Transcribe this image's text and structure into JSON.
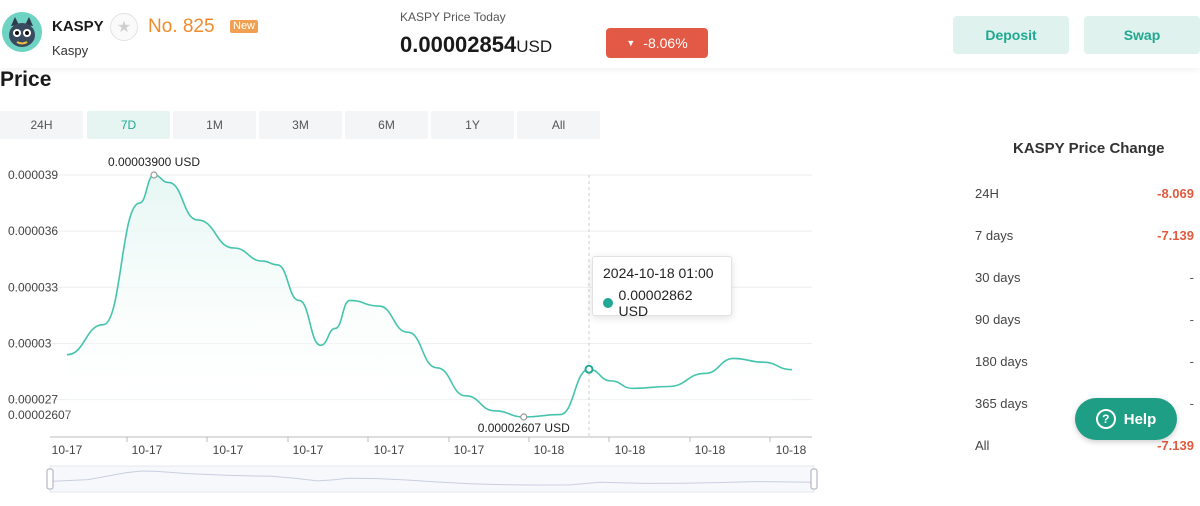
{
  "header": {
    "symbol": "KASPY",
    "name": "Kaspy",
    "rank": "No. 825",
    "new_badge": "New",
    "price_label": "KASPY Price Today",
    "price": "0.00002854",
    "price_unit": "USD",
    "change": "-8.06%",
    "deposit_label": "Deposit",
    "swap_label": "Swap"
  },
  "section_title": "Price",
  "tabs": [
    {
      "label": "24H"
    },
    {
      "label": "7D",
      "active": true
    },
    {
      "label": "1M"
    },
    {
      "label": "3M"
    },
    {
      "label": "6M"
    },
    {
      "label": "1Y"
    },
    {
      "label": "All"
    }
  ],
  "tooltip": {
    "date": "2024-10-18 01:00",
    "value": "0.00002862 USD"
  },
  "chart_data": {
    "type": "area",
    "x_tick_labels": [
      "10-17",
      "10-17",
      "10-17",
      "10-17",
      "10-17",
      "10-17",
      "10-18",
      "10-18",
      "10-18",
      "10-18"
    ],
    "y_tick_labels": [
      "0.000039",
      "0.000036",
      "0.000033",
      "0.00003",
      "0.000027",
      "0.00002607"
    ],
    "ylim": [
      2.607e-05,
      3.9e-05
    ],
    "points": [
      {
        "x": 0,
        "y": 2.94e-05
      },
      {
        "x": 5,
        "y": 3.1e-05
      },
      {
        "x": 10,
        "y": 3.75e-05
      },
      {
        "x": 12,
        "y": 3.9e-05
      },
      {
        "x": 14,
        "y": 3.86e-05
      },
      {
        "x": 18,
        "y": 3.66e-05
      },
      {
        "x": 23,
        "y": 3.51e-05
      },
      {
        "x": 27,
        "y": 3.44e-05
      },
      {
        "x": 29,
        "y": 3.42e-05
      },
      {
        "x": 32,
        "y": 3.23e-05
      },
      {
        "x": 35,
        "y": 2.99e-05
      },
      {
        "x": 37,
        "y": 3.08e-05
      },
      {
        "x": 39,
        "y": 3.23e-05
      },
      {
        "x": 43,
        "y": 3.2e-05
      },
      {
        "x": 47,
        "y": 3.06e-05
      },
      {
        "x": 51,
        "y": 2.87e-05
      },
      {
        "x": 55,
        "y": 2.72e-05
      },
      {
        "x": 59,
        "y": 2.64e-05
      },
      {
        "x": 63,
        "y": 2.607e-05
      },
      {
        "x": 68,
        "y": 2.62e-05
      },
      {
        "x": 72,
        "y": 2.862e-05
      },
      {
        "x": 75,
        "y": 2.8e-05
      },
      {
        "x": 78,
        "y": 2.76e-05
      },
      {
        "x": 83,
        "y": 2.77e-05
      },
      {
        "x": 88,
        "y": 2.84e-05
      },
      {
        "x": 92,
        "y": 2.92e-05
      },
      {
        "x": 96,
        "y": 2.9e-05
      },
      {
        "x": 100,
        "y": 2.86e-05
      }
    ],
    "annotations": [
      {
        "text": "0.00003900  USD",
        "x": 12,
        "y": 3.9e-05
      },
      {
        "text": "0.00002607  USD",
        "x": 63,
        "y": 2.607e-05
      }
    ],
    "highlight": {
      "x": 72,
      "y": 2.862e-05
    },
    "grid": true,
    "line_color": "#45c4ad",
    "fill_color": "#e6f7f3"
  },
  "change_panel": {
    "title": "KASPY Price Change",
    "rows": [
      {
        "label": "24H",
        "value": "-8.069"
      },
      {
        "label": "7 days",
        "value": "-7.139"
      },
      {
        "label": "30 days",
        "value": "-"
      },
      {
        "label": "90 days",
        "value": "-"
      },
      {
        "label": "180 days",
        "value": "-"
      },
      {
        "label": "365 days",
        "value": "-"
      },
      {
        "label": "All",
        "value": "-7.139"
      }
    ]
  },
  "help_label": "Help"
}
